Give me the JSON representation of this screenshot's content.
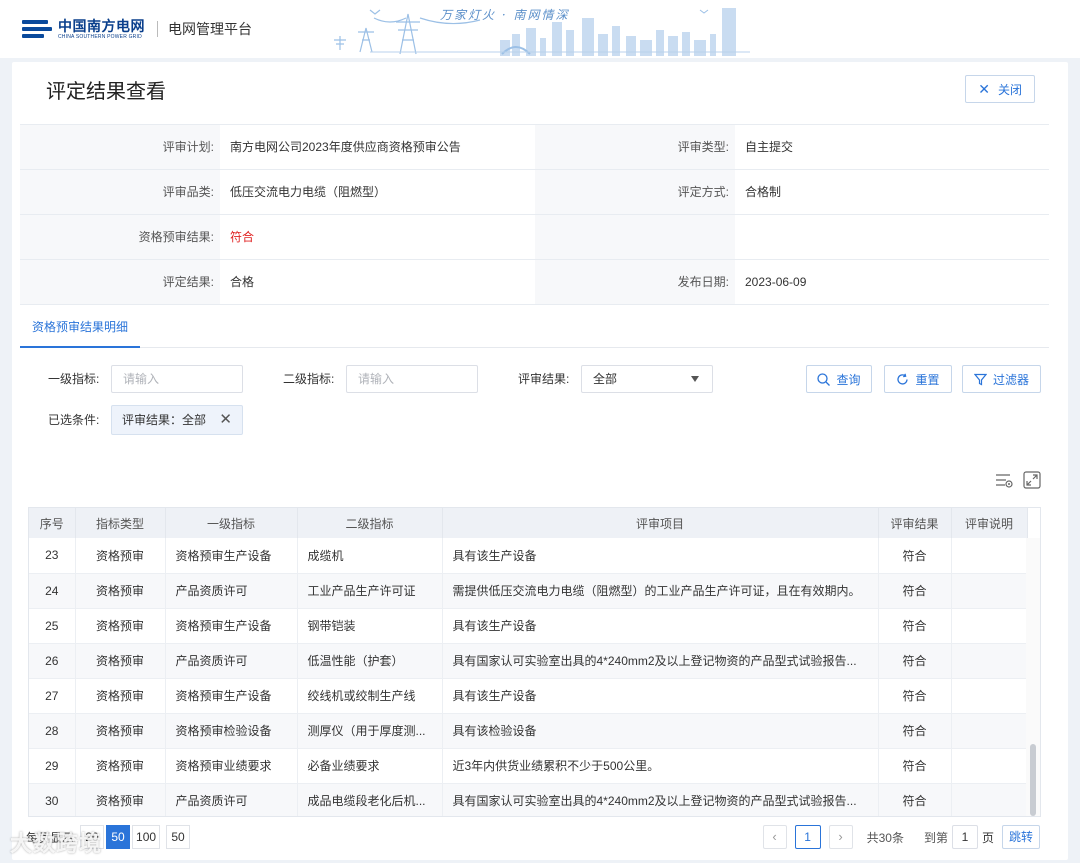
{
  "header": {
    "logo_cn": "中国南方电网",
    "logo_en": "CHINA SOUTHERN POWER GRID",
    "platform": "电网管理平台",
    "slogan": "万家灯火 · 南网情深"
  },
  "page": {
    "title": "评定结果查看",
    "close_label": "关闭"
  },
  "info": {
    "plan_label": "评审计划:",
    "plan_value": "南方电网公司2023年度供应商资格预审公告",
    "type_label": "评审类型:",
    "type_value": "自主提交",
    "category_label": "评审品类:",
    "category_value": "低压交流电力电缆（阻燃型）",
    "method_label": "评定方式:",
    "method_value": "合格制",
    "prequal_label": "资格预审结果:",
    "prequal_value": "符合",
    "result_label": "评定结果:",
    "result_value": "合格",
    "date_label": "发布日期:",
    "date_value": "2023-06-09"
  },
  "tab": {
    "label": "资格预审结果明细"
  },
  "filters": {
    "level1_label": "一级指标:",
    "level1_placeholder": "请输入",
    "level2_label": "二级指标:",
    "level2_placeholder": "请输入",
    "result_label": "评审结果:",
    "result_value": "全部",
    "search_label": "查询",
    "reset_label": "重置",
    "filter_label": "过滤器"
  },
  "selected": {
    "label": "已选条件:",
    "chip": "评审结果：全部"
  },
  "table": {
    "headers": [
      "序号",
      "指标类型",
      "一级指标",
      "二级指标",
      "评审项目",
      "评审结果",
      "评审说明"
    ],
    "rows": [
      [
        "23",
        "资格预审",
        "资格预审生产设备",
        "成缆机",
        "具有该生产设备",
        "符合",
        ""
      ],
      [
        "24",
        "资格预审",
        "产品资质许可",
        "工业产品生产许可证",
        "需提供低压交流电力电缆（阻燃型）的工业产品生产许可证，且在有效期内。",
        "符合",
        ""
      ],
      [
        "25",
        "资格预审",
        "资格预审生产设备",
        "钢带铠装",
        "具有该生产设备",
        "符合",
        ""
      ],
      [
        "26",
        "资格预审",
        "产品资质许可",
        "低温性能（护套）",
        "具有国家认可实验室出具的4*240mm2及以上登记物资的产品型式试验报告...",
        "符合",
        ""
      ],
      [
        "27",
        "资格预审",
        "资格预审生产设备",
        "绞线机或绞制生产线",
        "具有该生产设备",
        "符合",
        ""
      ],
      [
        "28",
        "资格预审",
        "资格预审检验设备",
        "测厚仪（用于厚度测...",
        "具有该检验设备",
        "符合",
        ""
      ],
      [
        "29",
        "资格预审",
        "资格预审业绩要求",
        "必备业绩要求",
        "近3年内供货业绩累积不少于500公里。",
        "符合",
        ""
      ],
      [
        "30",
        "资格预审",
        "产品资质许可",
        "成品电缆段老化后机...",
        "具有国家认可实验室出具的4*240mm2及以上登记物资的产品型式试验报告...",
        "符合",
        ""
      ]
    ]
  },
  "pagination": {
    "page_size_label": "每页显示",
    "sizes": [
      "20",
      "50",
      "100"
    ],
    "current_size": "50",
    "current_page": "1",
    "total": "共30条",
    "goto_label": "到第",
    "goto_value": "1",
    "page_unit": "页",
    "jump_label": "跳转"
  },
  "watermark": "大数跨境",
  "colors": {
    "accent": "#2a74d9",
    "brand": "#0a4a9c",
    "match": "#e02424"
  }
}
